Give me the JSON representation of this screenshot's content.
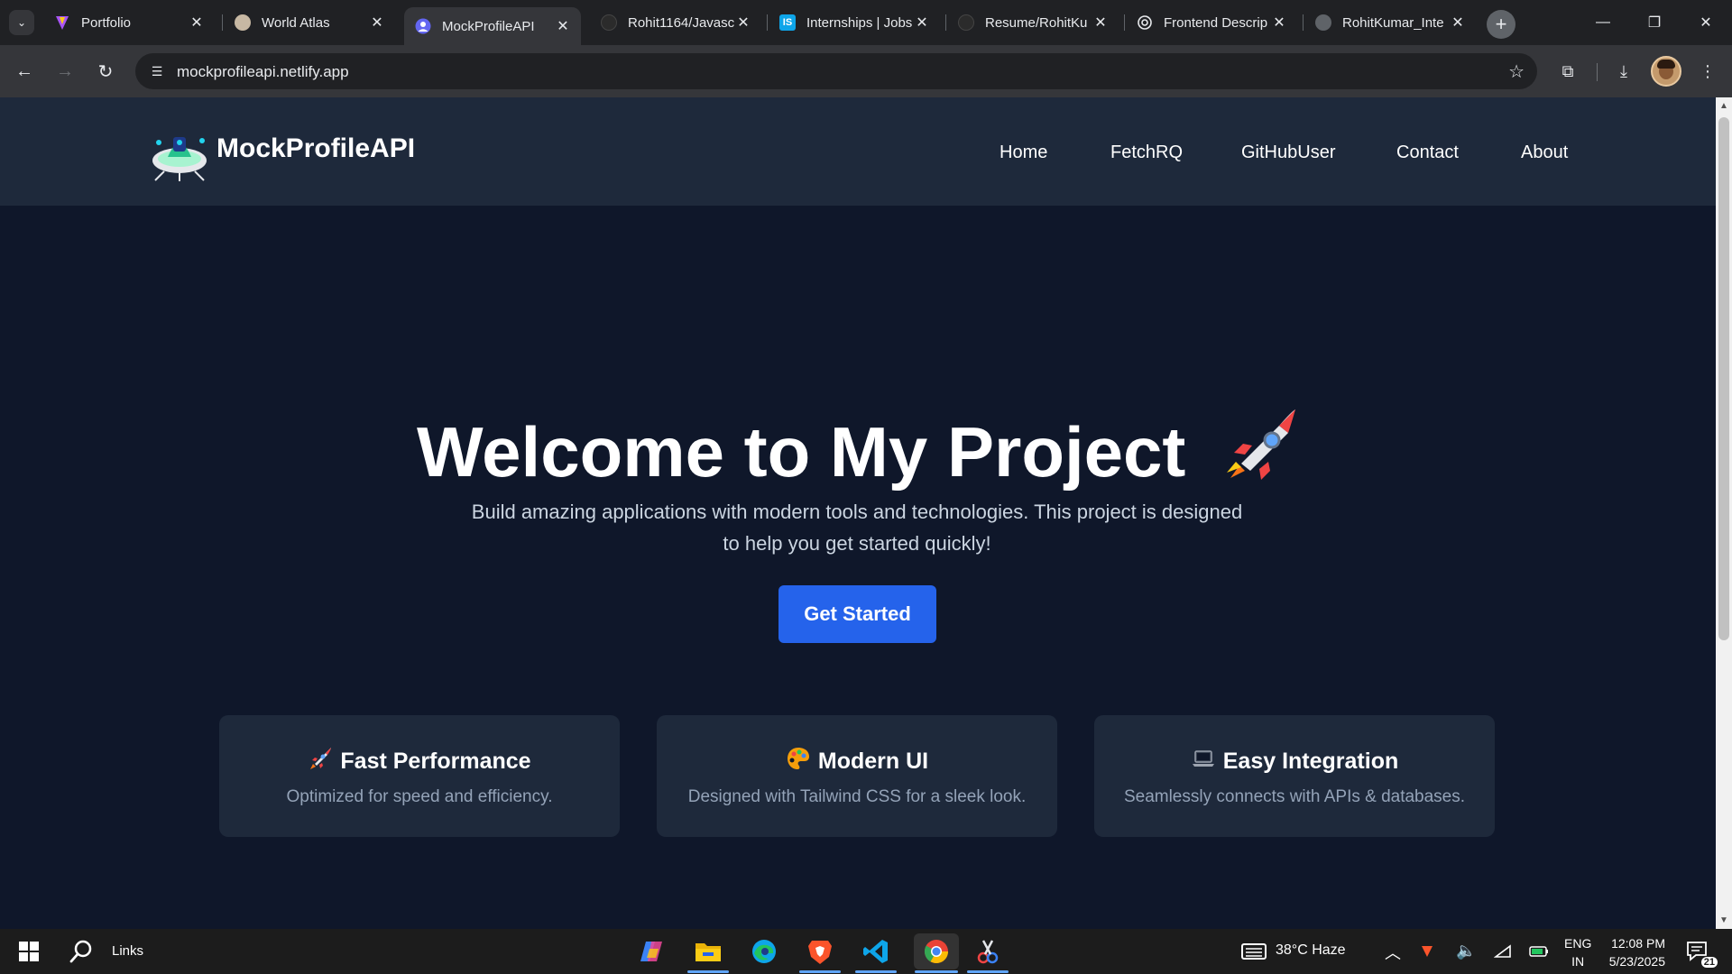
{
  "browser": {
    "tabs": [
      {
        "title": "Portfolio",
        "favicon": "vite-icon",
        "active": false
      },
      {
        "title": "World Atlas",
        "favicon": "globe-icon",
        "active": false
      },
      {
        "title": "MockProfileAPI",
        "favicon": "profile-icon",
        "active": true
      },
      {
        "title": "Rohit1164/Javasc",
        "favicon": "github-icon",
        "active": false
      },
      {
        "title": "Internships | Jobs",
        "favicon": "internshala-icon",
        "active": false
      },
      {
        "title": "Resume/RohitKu",
        "favicon": "github-icon",
        "active": false
      },
      {
        "title": "Frontend Descrip",
        "favicon": "openai-icon",
        "active": false
      },
      {
        "title": "RohitKumar_Inte",
        "favicon": "globe-icon",
        "active": false
      }
    ],
    "new_tab_symbol": "+",
    "address": "mockprofileapi.netlify.app"
  },
  "site": {
    "brand": "MockProfileAPI",
    "nav": [
      "Home",
      "FetchRQ",
      "GitHubUser",
      "Contact",
      "About"
    ],
    "hero": {
      "title": "Welcome to My Project",
      "title_icon": "rocket-icon",
      "subtitle": "Build amazing applications with modern tools and technologies. This project is designed to help you get started quickly!",
      "cta_label": "Get Started"
    },
    "features": [
      {
        "icon": "rocket-icon",
        "title": "Fast Performance",
        "description": "Optimized for speed and efficiency."
      },
      {
        "icon": "palette-icon",
        "title": "Modern UI",
        "description": "Designed with Tailwind CSS for a sleek look."
      },
      {
        "icon": "laptop-icon",
        "title": "Easy Integration",
        "description": "Seamlessly connects with APIs & databases."
      }
    ],
    "colors": {
      "background": "#0f172a",
      "nav": "#1e293b",
      "accent": "#2563eb"
    }
  },
  "taskbar": {
    "search_label": "Links",
    "weather": "38°C  Haze",
    "language": [
      "ENG",
      "IN"
    ],
    "time": "12:08 PM",
    "date": "5/23/2025",
    "notifications": "21"
  }
}
